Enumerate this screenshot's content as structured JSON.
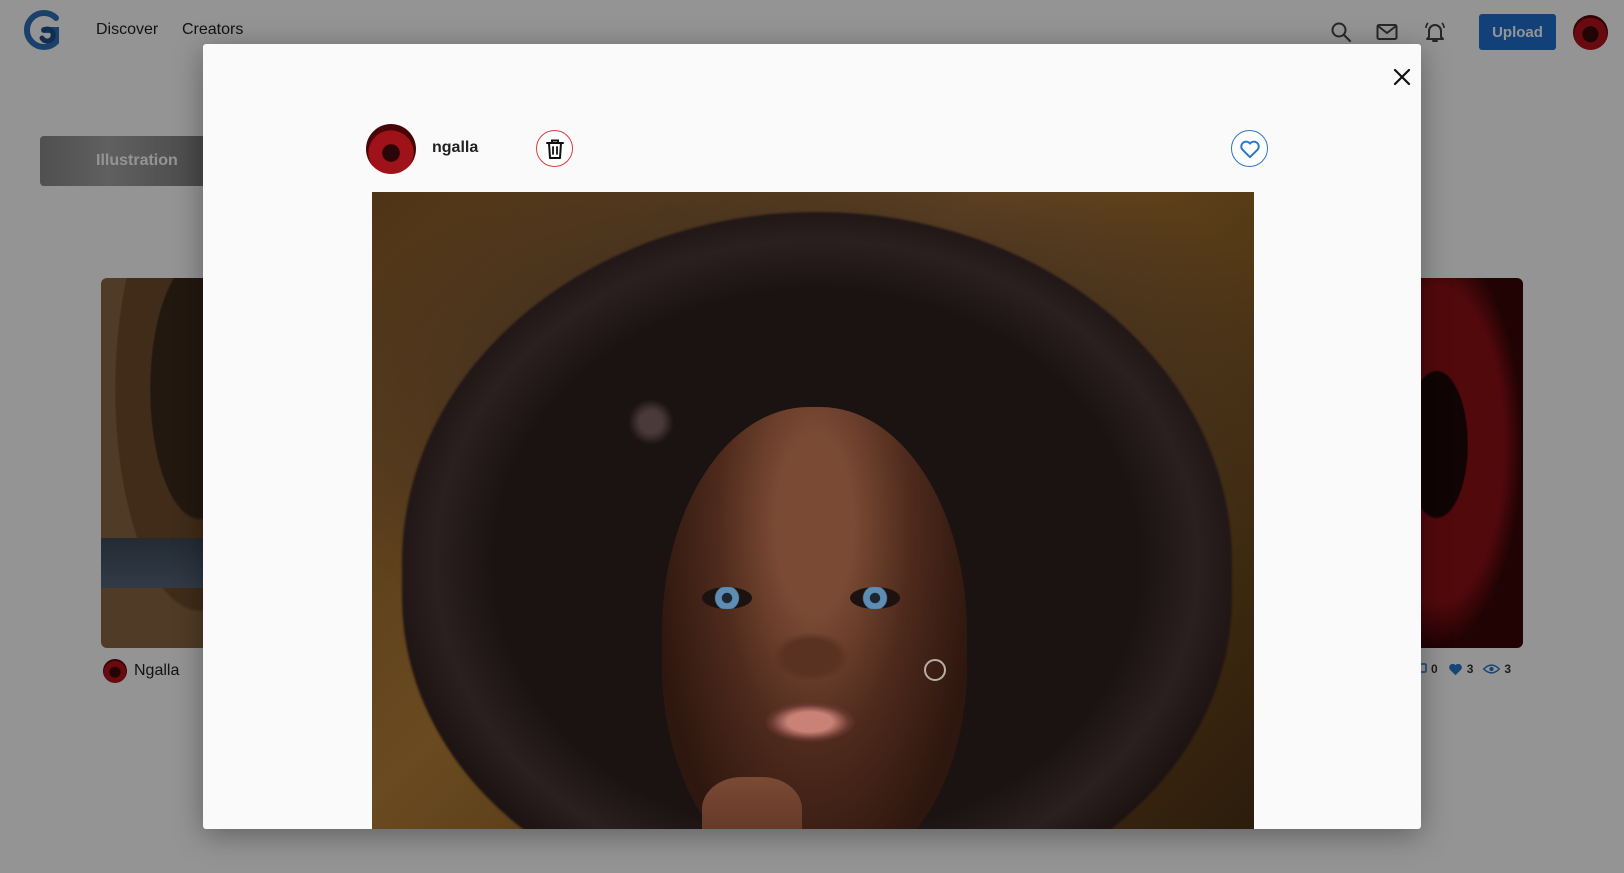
{
  "topbar": {
    "nav": {
      "discover": "Discover",
      "creators": "Creators"
    },
    "icons": {
      "search": "search-icon",
      "mail": "mail-icon",
      "bell": "bell-icon"
    },
    "upload_label": "Upload"
  },
  "background": {
    "category_label": "Illustration",
    "card_author": "Ngalla",
    "card_stats": {
      "comments": "0",
      "likes": "3",
      "views": "3"
    }
  },
  "modal": {
    "author_name": "ngalla",
    "artwork_alt": "artwork"
  },
  "colors": {
    "accent": "#1f6fd1",
    "delete": "#e23b3b",
    "like": "#2a78c8",
    "backdrop": "rgba(0,0,0,0.42)"
  }
}
